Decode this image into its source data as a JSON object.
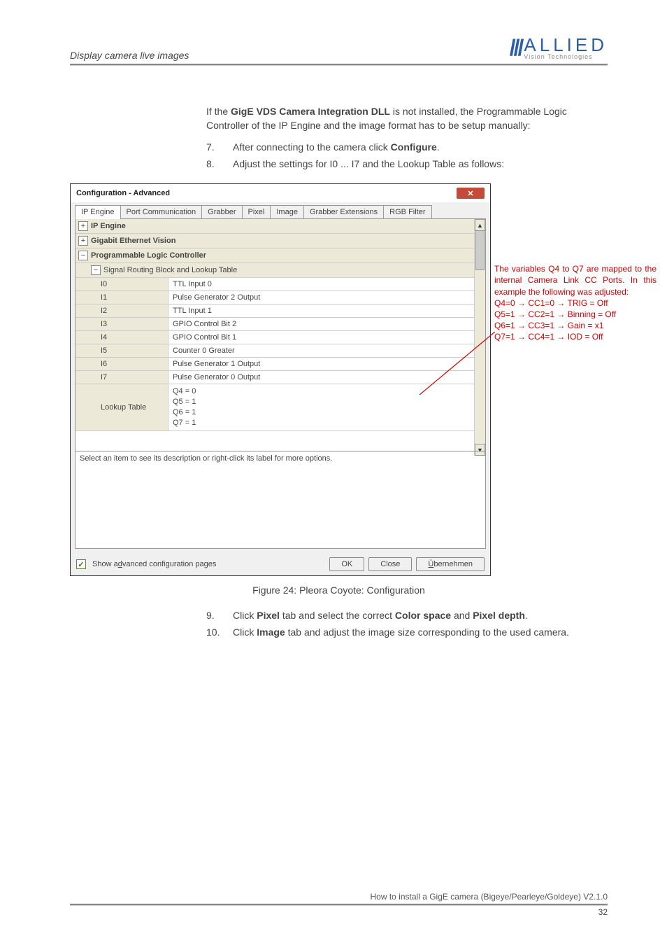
{
  "header": {
    "title": "Display camera live images",
    "logo_main": "ALLIED",
    "logo_sub": "Vision Technologies"
  },
  "intro": "If the GigE VDS Camera Integration DLL is not installed, the Programmable Logic Controller of the IP Engine and the image format has to be setup manually:",
  "intro_bold": "GigE VDS Camera Integration DLL",
  "steps78": [
    {
      "num": "7.",
      "text_before": "After connecting to the camera click ",
      "bold": "Configure",
      "text_after": "."
    },
    {
      "num": "8.",
      "text_before": "Adjust the settings for I0 ... I7 and the Lookup Table as follows:",
      "bold": "",
      "text_after": ""
    }
  ],
  "dialog": {
    "title": "Configuration - Advanced",
    "tabs": [
      "IP Engine",
      "Port Communication",
      "Grabber",
      "Pixel",
      "Image",
      "Grabber Extensions",
      "RGB Filter"
    ],
    "active_tab": 0,
    "categories": {
      "ip_engine": "IP Engine",
      "gig_ev": "Gigabit Ethernet Vision",
      "plc": "Programmable Logic Controller",
      "signal_block": "Signal Routing Block and Lookup Table"
    },
    "rows": [
      {
        "name": "I0",
        "val": "TTL Input 0"
      },
      {
        "name": "I1",
        "val": "Pulse Generator 2 Output"
      },
      {
        "name": "I2",
        "val": "TTL Input 1"
      },
      {
        "name": "I3",
        "val": "GPIO Control Bit 2"
      },
      {
        "name": "I4",
        "val": "GPIO Control Bit 1"
      },
      {
        "name": "I5",
        "val": "Counter 0 Greater"
      },
      {
        "name": "I6",
        "val": "Pulse Generator 1 Output"
      },
      {
        "name": "I7",
        "val": "Pulse Generator 0 Output"
      }
    ],
    "lookup_name": "Lookup Table",
    "lookup_vals": [
      "Q4 = 0",
      "Q5 = 1",
      "Q6 = 1",
      "Q7 = 1"
    ],
    "desc_placeholder": "Select an item to see its description or right-click its label for more options.",
    "footer": {
      "checkbox_label": "Show advanced configuration pages",
      "checkbox_underline1": "d",
      "buttons": [
        "OK",
        "Close",
        "Übernehmen"
      ]
    }
  },
  "callout": {
    "line1": "The variables Q4 to Q7 are mapped to the internal Camera Link CC Ports. In this example the following was adjusted:",
    "lines": [
      "Q4=0 → CC1=0 → TRIG = Off",
      "Q5=1 → CC2=1 → Binning = Off",
      "Q6=1 → CC3=1 → Gain = x1",
      "Q7=1 → CC4=1 → IOD = Off"
    ]
  },
  "fig_caption": "Figure 24: Pleora Coyote: Configuration",
  "steps910": [
    {
      "num": "9.",
      "parts": [
        "Click ",
        "Pixel",
        " tab and select the correct ",
        "Color space",
        " and ",
        "Pixel depth",
        "."
      ]
    },
    {
      "num": "10.",
      "parts": [
        "Click ",
        "Image",
        " tab and adjust the image size corresponding to the used camera."
      ]
    }
  ],
  "footer": {
    "text": "How to install a GigE camera (Bigeye/Pearleye/Goldeye) V2.1.0",
    "page": "32"
  }
}
